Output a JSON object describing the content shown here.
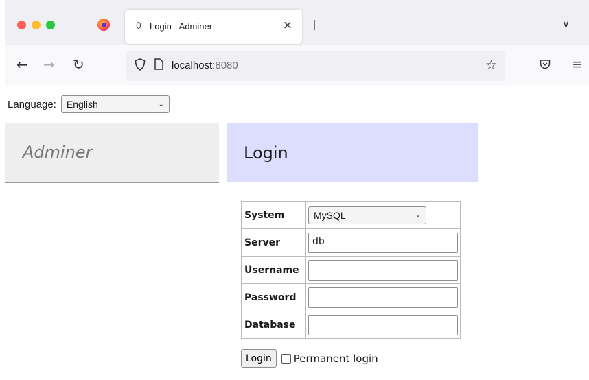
{
  "browser": {
    "tab": {
      "title": "Login - Adminer",
      "favicon": "adminer-favicon-icon",
      "close": "×"
    },
    "new_tab": "+",
    "tab_list": "∨",
    "url": {
      "host": "localhost",
      "port": ":8080"
    }
  },
  "page": {
    "language": {
      "label": "Language:",
      "selected": "English"
    },
    "brand": "Adminer",
    "heading": "Login",
    "form": {
      "system": {
        "label": "System",
        "value": "MySQL"
      },
      "server": {
        "label": "Server",
        "value": "db"
      },
      "username": {
        "label": "Username",
        "value": ""
      },
      "password": {
        "label": "Password",
        "value": ""
      },
      "database": {
        "label": "Database",
        "value": ""
      }
    },
    "login_button": "Login",
    "permanent_login": "Permanent login"
  },
  "colors": {
    "heading_bg": "#ddddff",
    "brand_bg": "#eeeeee"
  }
}
